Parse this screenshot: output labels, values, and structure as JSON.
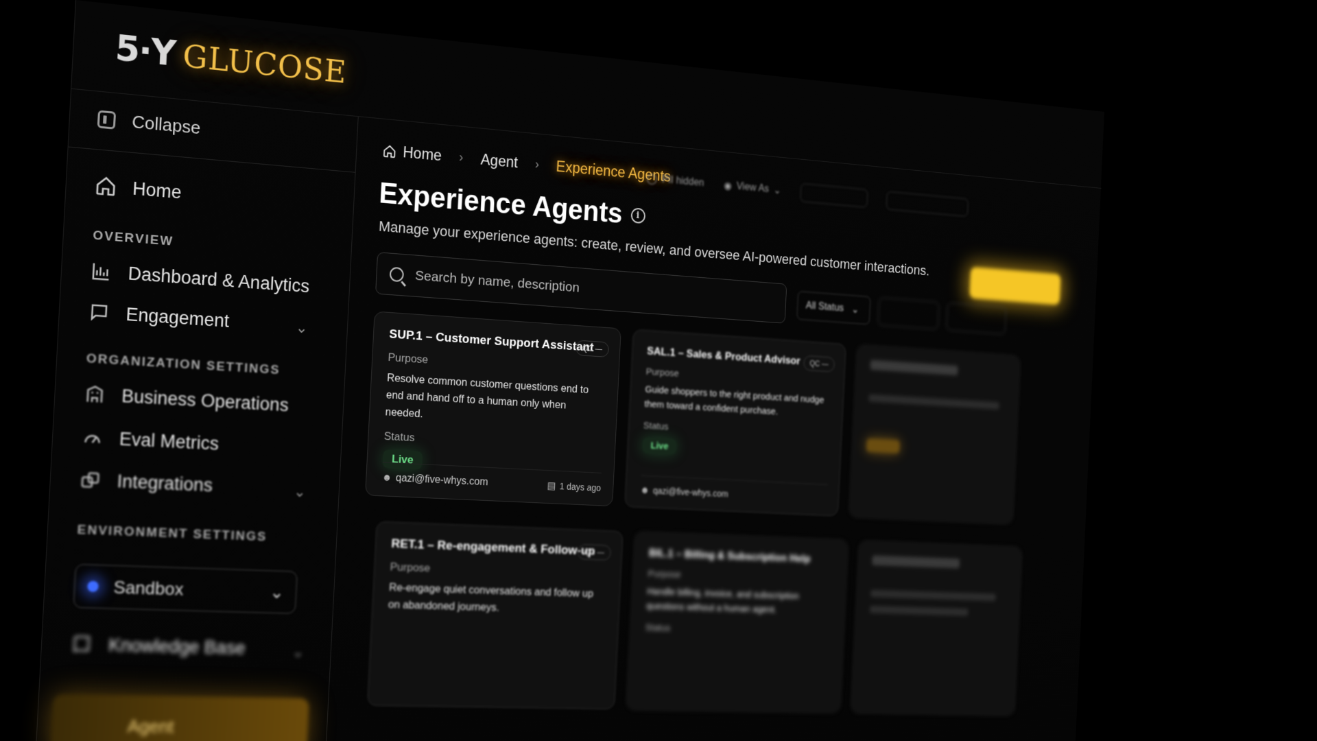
{
  "brand": {
    "mark": "5·Y",
    "word": "GLUCOSE",
    "accent": "#f3c04a"
  },
  "sidebar": {
    "collapse_label": "Collapse",
    "home_label": "Home",
    "overview_label": "OVERVIEW",
    "dashboard_label": "Dashboard & Analytics",
    "engagement_label": "Engagement",
    "org_settings_label": "ORGANIZATION SETTINGS",
    "business_ops_label": "Business Operations",
    "eval_metrics_label": "Eval Metrics",
    "integrations_label": "Integrations",
    "env_settings_label": "ENVIRONMENT SETTINGS",
    "environment_value": "Sandbox",
    "knowledge_base_label": "Knowledge Base",
    "agent_label": "Agent"
  },
  "breadcrumb": {
    "home": "Home",
    "agent": "Agent",
    "current": "Experience Agents"
  },
  "toolbar": {
    "pii": "PII hidden",
    "view_as": "View As"
  },
  "page": {
    "title": "Experience Agents",
    "subtitle": "Manage your experience agents: create, review, and oversee AI-powered customer interactions."
  },
  "search": {
    "placeholder": "Search by name, description"
  },
  "filters": {
    "status": "All Status"
  },
  "cards": [
    {
      "title": "SUP.1 – Customer Support Assistant",
      "badge": "QC —",
      "purpose_label": "Purpose",
      "purpose": "Resolve common customer questions end to end and hand off to a human only when needed.",
      "status_label": "Status",
      "status": "Live",
      "owner": "qazi@five-whys.com",
      "updated": "1 days ago"
    },
    {
      "title": "SAL.1 – Sales & Product Advisor",
      "badge": "QC —",
      "purpose_label": "Purpose",
      "purpose": "Guide shoppers to the right product and nudge them toward a confident purchase.",
      "status_label": "Status",
      "status": "Live",
      "owner": "qazi@five-whys.com"
    },
    {
      "title": "RET.1 – Re-engagement & Follow-up",
      "badge": "QC —",
      "purpose_label": "Purpose",
      "purpose": "Re-engage quiet conversations and follow up on abandoned journeys."
    },
    {
      "title": "BIL.1 – Billing & Subscription Help",
      "purpose_label": "Purpose",
      "purpose": "Handle billing, invoice, and subscription questions without a human agent.",
      "status_label": "Status"
    }
  ],
  "colors": {
    "live": "#6ee08a",
    "primary_button": "#f5c626",
    "env_dot": "#3e6cff"
  }
}
